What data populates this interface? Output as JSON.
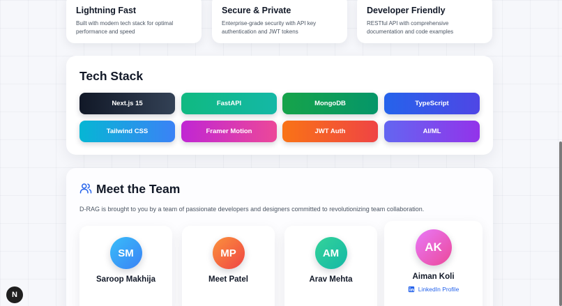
{
  "features": [
    {
      "title": "Lightning Fast",
      "desc": "Built with modern tech stack for optimal performance and speed"
    },
    {
      "title": "Secure & Private",
      "desc": "Enterprise-grade security with API key authentication and JWT tokens"
    },
    {
      "title": "Developer Friendly",
      "desc": "RESTful API with comprehensive documentation and code examples"
    }
  ],
  "tech_stack": {
    "title": "Tech Stack",
    "items": [
      {
        "label": "Next.js 15",
        "color": "#1e293b"
      },
      {
        "label": "FastAPI",
        "color": "#10b981"
      },
      {
        "label": "MongoDB",
        "color": "#16a34a"
      },
      {
        "label": "TypeScript",
        "color": "#2563eb"
      },
      {
        "label": "Tailwind CSS",
        "color": "#0ea5e9"
      },
      {
        "label": "Framer Motion",
        "color": "#c026d3"
      },
      {
        "label": "JWT Auth",
        "color": "#f97316"
      },
      {
        "label": "AI/ML",
        "color": "#7c3aed"
      }
    ]
  },
  "team": {
    "title": "Meet the Team",
    "description": "D-RAG is brought to you by a team of passionate developers and designers committed to revolutionizing team collaboration.",
    "icon": "users-icon",
    "members": [
      {
        "initials": "SM",
        "name": "Saroop Makhija",
        "color": "#38bdf8"
      },
      {
        "initials": "MP",
        "name": "Meet Patel",
        "color": "#fb923c"
      },
      {
        "initials": "AM",
        "name": "Arav Mehta",
        "color": "#34d399"
      },
      {
        "initials": "AK",
        "name": "Aiman Koli",
        "color": "#e879f9",
        "link": "LinkedIn Profile"
      }
    ]
  },
  "badge": {
    "label": "N"
  },
  "colors": {
    "accent": "#2563eb",
    "title": "#111827"
  }
}
